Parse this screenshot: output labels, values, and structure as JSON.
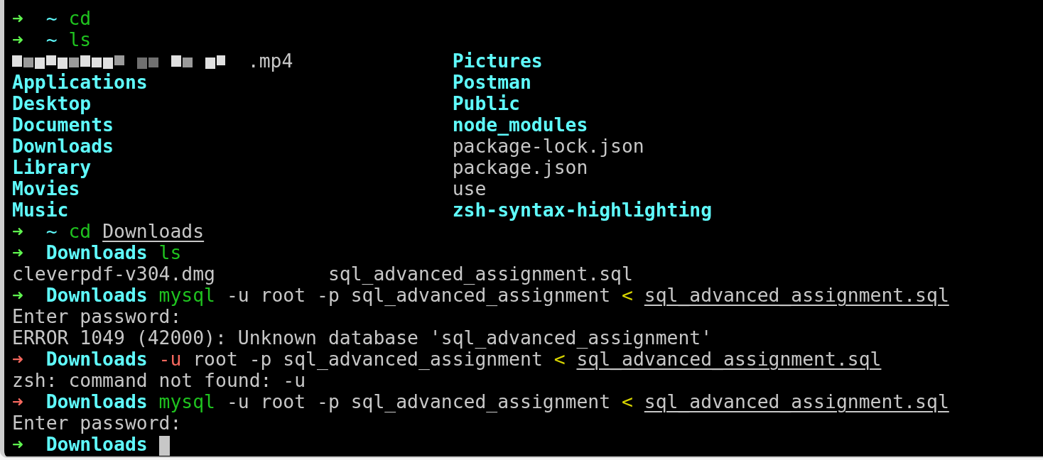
{
  "terminal": {
    "lines": [
      {
        "kind": "prompt",
        "arrow": "➜",
        "error": false,
        "dir": "~",
        "segments": [
          {
            "kind": "command",
            "text": "cd"
          }
        ]
      },
      {
        "kind": "prompt",
        "arrow": "➜",
        "error": false,
        "dir": "~",
        "segments": [
          {
            "kind": "command",
            "text": "ls"
          }
        ]
      },
      {
        "kind": "listing",
        "rows": [
          [
            {
              "kind": "redacted",
              "text": ".mp4"
            },
            {
              "kind": "dir",
              "text": "Pictures"
            }
          ],
          [
            {
              "kind": "dir",
              "text": "Applications"
            },
            {
              "kind": "dir",
              "text": "Postman"
            }
          ],
          [
            {
              "kind": "dir",
              "text": "Desktop"
            },
            {
              "kind": "dir",
              "text": "Public"
            }
          ],
          [
            {
              "kind": "dir",
              "text": "Documents"
            },
            {
              "kind": "dir",
              "text": "node_modules"
            }
          ],
          [
            {
              "kind": "dir",
              "text": "Downloads"
            },
            {
              "kind": "file",
              "text": "package-lock.json"
            }
          ],
          [
            {
              "kind": "dir",
              "text": "Library"
            },
            {
              "kind": "file",
              "text": "package.json"
            }
          ],
          [
            {
              "kind": "dir",
              "text": "Movies"
            },
            {
              "kind": "file",
              "text": "use"
            }
          ],
          [
            {
              "kind": "dir",
              "text": "Music"
            },
            {
              "kind": "dir",
              "text": "zsh-syntax-highlighting"
            }
          ]
        ]
      },
      {
        "kind": "prompt",
        "arrow": "➜",
        "error": false,
        "dir": "~",
        "segments": [
          {
            "kind": "command",
            "text": "cd"
          },
          {
            "kind": "path",
            "text": "Downloads"
          }
        ]
      },
      {
        "kind": "prompt",
        "arrow": "➜",
        "error": false,
        "dir": "Downloads",
        "segments": [
          {
            "kind": "command",
            "text": "ls"
          }
        ]
      },
      {
        "kind": "listing",
        "rows": [
          [
            {
              "kind": "file",
              "text": "cleverpdf-v304.dmg"
            },
            {
              "kind": "file",
              "text": "sql_advanced_assignment.sql"
            }
          ]
        ]
      },
      {
        "kind": "prompt",
        "arrow": "➜",
        "error": false,
        "dir": "Downloads",
        "segments": [
          {
            "kind": "command",
            "text": "mysql"
          },
          {
            "kind": "args",
            "text": "-u root -p sql_advanced_assignment"
          },
          {
            "kind": "redirect",
            "text": "<"
          },
          {
            "kind": "path",
            "text": "sql_advanced_assignment.sql"
          }
        ]
      },
      {
        "kind": "output",
        "text": "Enter password:"
      },
      {
        "kind": "output",
        "text": "ERROR 1049 (42000): Unknown database 'sql_advanced_assignment'"
      },
      {
        "kind": "prompt",
        "arrow": "➜",
        "error": true,
        "dir": "Downloads",
        "segments": [
          {
            "kind": "bad-command",
            "text": "-u"
          },
          {
            "kind": "args",
            "text": "root -p sql_advanced_assignment"
          },
          {
            "kind": "redirect",
            "text": "<"
          },
          {
            "kind": "path",
            "text": "sql_advanced_assignment.sql"
          }
        ]
      },
      {
        "kind": "output",
        "text": "zsh: command not found: -u"
      },
      {
        "kind": "prompt",
        "arrow": "➜",
        "error": true,
        "dir": "Downloads",
        "segments": [
          {
            "kind": "command",
            "text": "mysql"
          },
          {
            "kind": "args",
            "text": "-u root -p sql_advanced_assignment"
          },
          {
            "kind": "redirect",
            "text": "<"
          },
          {
            "kind": "path",
            "text": "sql_advanced_assignment.sql"
          }
        ]
      },
      {
        "kind": "output",
        "text": "Enter password:"
      },
      {
        "kind": "prompt",
        "arrow": "➜",
        "error": false,
        "dir": "Downloads",
        "cursor": true
      }
    ]
  }
}
